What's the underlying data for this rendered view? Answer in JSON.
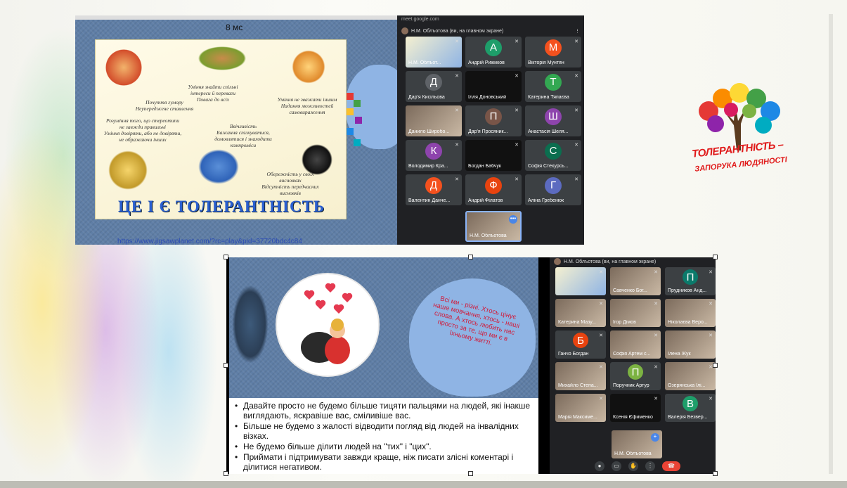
{
  "slide1": {
    "timer": "8 мс",
    "poster_lines": [
      "Почуття гумору",
      "Неупереджене ставлення",
      "Уміння знайти спільні",
      "інтереси й переваги",
      "Повага до всіх",
      "Уміння не зважати іншим",
      "Надання можливостей",
      "самовираження",
      "Розуміння того, що стереотипи",
      "не завжди правильні",
      "Уміння довіряти, або не довіряти,",
      "не ображаючи інших",
      "Ввічливість",
      "Бажання спілкуватися,",
      "домовлятися і знаходити",
      "компроміси",
      "Обережність у своїх",
      "висновках",
      "Відсутність передчасних",
      "висновків"
    ],
    "poster_title": "ЦЕ І Є ТОЛЕРАНТНІСТЬ",
    "link": "https://www.jigsawplanet.com/?rc=play&pid=37720bdc4c84"
  },
  "meet1": {
    "top": "meet.google.com",
    "presenter": "Н.М. Облъотова (ви, на главном экране)",
    "tiles": [
      {
        "name": "Н.М. Облъот...",
        "letter": "",
        "color": "",
        "kind": "screen"
      },
      {
        "name": "Андрій Рижиков",
        "letter": "А",
        "color": "#1e9e6a",
        "kind": "avatar"
      },
      {
        "name": "Вікторія Мунтян",
        "letter": "М",
        "color": "#f4511e",
        "kind": "avatar"
      },
      {
        "name": "Дар'я Кисільова",
        "letter": "Д",
        "color": "#5f6368",
        "kind": "avatar"
      },
      {
        "name": "Ілля Доновський",
        "letter": "",
        "color": "#111111",
        "kind": "photo"
      },
      {
        "name": "Катерина Тяпаєва",
        "letter": "Т",
        "color": "#33a852",
        "kind": "avatar"
      },
      {
        "name": "Данило Широбо...",
        "letter": "",
        "color": "",
        "kind": "photo"
      },
      {
        "name": "Дар'я Просяник...",
        "letter": "П",
        "color": "#795548",
        "kind": "avatar"
      },
      {
        "name": "Анастасія Шеля...",
        "letter": "Ш",
        "color": "#8e44ad",
        "kind": "avatar"
      },
      {
        "name": "Володимир Кра...",
        "letter": "К",
        "color": "#8e44ad",
        "kind": "avatar"
      },
      {
        "name": "Богдан Бабчук",
        "letter": "",
        "color": "#111111",
        "kind": "photo"
      },
      {
        "name": "Софія Стехурсь...",
        "letter": "С",
        "color": "#0b6e4f",
        "kind": "avatar"
      },
      {
        "name": "Валентин Данче...",
        "letter": "Д",
        "color": "#f4511e",
        "kind": "avatar"
      },
      {
        "name": "Андрій Філатов",
        "letter": "Ф",
        "color": "#e8430f",
        "kind": "avatar"
      },
      {
        "name": "Аліна Гребенюк",
        "letter": "Г",
        "color": "#5c6bc0",
        "kind": "avatar"
      }
    ],
    "self": "Н.М. Облъотова"
  },
  "logo": {
    "line1": "ТОЛЕРАНТНІСТЬ –",
    "line2": "ЗАПОРУКА ЛЮДЯНОСТІ"
  },
  "slide2": {
    "heart_text": "Всі ми - різні. Хтось цінує наше мовчання, хтось - наші слова. А хтось любить нас просто за те, що ми є в їхньому житті.",
    "bullets": [
      "Давайте просто не будемо більше тицяти пальцями на людей, які інакше виглядають, яскравіше вас, сміливіше вас.",
      "Більше не будемо з жалості відводити погляд від людей на інвалідних візках.",
      "Не будемо більше ділити людей на \"тих\" і \"цих\".",
      "Приймати і підтримувати завжди краще, ніж писати злісні коментарі і ділитися негативом."
    ]
  },
  "meet2": {
    "presenter": "Н.М. Облъотова (ви, на главном экране)",
    "tiles": [
      {
        "name": "",
        "letter": "",
        "color": "",
        "kind": "screen"
      },
      {
        "name": "Савченко Бог...",
        "letter": "",
        "color": "",
        "kind": "photo"
      },
      {
        "name": "Прудников Анд...",
        "letter": "П",
        "color": "#0b7a6b",
        "kind": "avatar"
      },
      {
        "name": "Катерина Мазу...",
        "letter": "",
        "color": "",
        "kind": "photo"
      },
      {
        "name": "Ігор Дімов",
        "letter": "",
        "color": "",
        "kind": "photo"
      },
      {
        "name": "Ніколаєва Веро...",
        "letter": "",
        "color": "",
        "kind": "photo"
      },
      {
        "name": "Ганчо Богдан",
        "letter": "Б",
        "color": "#e8430f",
        "kind": "avatar"
      },
      {
        "name": "Софія Артем с...",
        "letter": "",
        "color": "",
        "kind": "photo"
      },
      {
        "name": "Ілена Жук",
        "letter": "",
        "color": "",
        "kind": "photo"
      },
      {
        "name": "Михайло Степа...",
        "letter": "",
        "color": "",
        "kind": "photo"
      },
      {
        "name": "Поручник Артур",
        "letter": "П",
        "color": "#7cb342",
        "kind": "avatar"
      },
      {
        "name": "Озерянська Ілі...",
        "letter": "",
        "color": "",
        "kind": "photo"
      },
      {
        "name": "Марія Максиме...",
        "letter": "",
        "color": "",
        "kind": "photo"
      },
      {
        "name": "Ксенія Єфименко",
        "letter": "",
        "color": "#111111",
        "kind": "photo"
      },
      {
        "name": "Валерія Безвер...",
        "letter": "В",
        "color": "#1e9e6a",
        "kind": "avatar"
      }
    ],
    "self": "Н.М. Облъотова"
  }
}
